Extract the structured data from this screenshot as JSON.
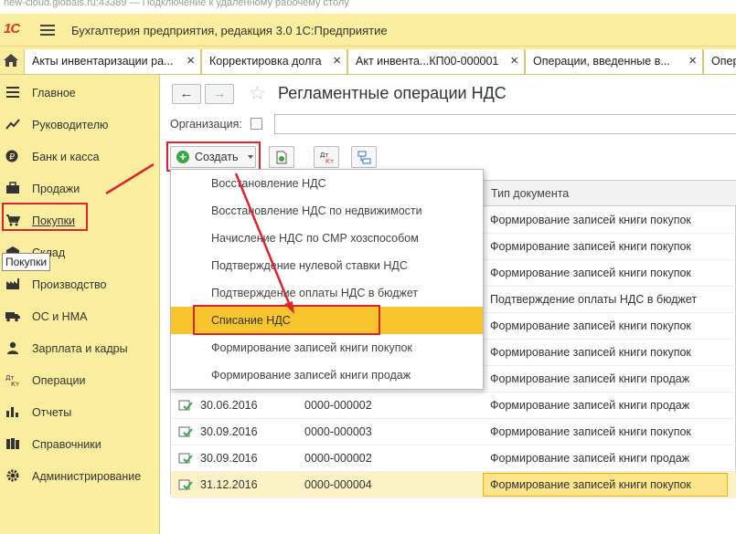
{
  "remote": {
    "title": "new-cloud.globals.ru:43389 — Подключение к удаленному рабочему столу"
  },
  "app": {
    "logo": "1С",
    "title": "Бухгалтерия предприятия, редакция 3.0 1С:Предприятие"
  },
  "tabs": [
    {
      "label": "Акты инвентаризации ра..."
    },
    {
      "label": "Корректировка долга"
    },
    {
      "label": "Акт инвента...КП00-000001"
    },
    {
      "label": "Операции, введенные в..."
    },
    {
      "label": "Опер"
    }
  ],
  "tab_close": "×",
  "sidebar": {
    "items": [
      {
        "label": "Главное",
        "icon": "menu-lines-icon"
      },
      {
        "label": "Руководителю",
        "icon": "chart-line-icon"
      },
      {
        "label": "Банк и касса",
        "icon": "ruble-coin-icon"
      },
      {
        "label": "Продажи",
        "icon": "briefcase-icon"
      },
      {
        "label": "Покупки",
        "icon": "cart-icon"
      },
      {
        "label": "Склад",
        "icon": "warehouse-icon"
      },
      {
        "label": "Производство",
        "icon": "factory-icon"
      },
      {
        "label": "ОС и НМА",
        "icon": "truck-icon"
      },
      {
        "label": "Зарплата и кадры",
        "icon": "person-icon"
      },
      {
        "label": "Операции",
        "icon": "dt-kt-icon"
      },
      {
        "label": "Отчеты",
        "icon": "bar-chart-icon"
      },
      {
        "label": "Справочники",
        "icon": "books-icon"
      },
      {
        "label": "Администрирование",
        "icon": "gear-icon"
      }
    ],
    "tooltip": "Покупки"
  },
  "page": {
    "title": "Регламентные операции НДС",
    "back": "←",
    "forward": "→",
    "star": "☆",
    "org_label": "Организация:",
    "create_label": "Создать"
  },
  "grid": {
    "col_type": "Тип документа",
    "rows_hidden_types": [
      "Формирование записей книги покупок",
      "Формирование записей книги покупок",
      "Формирование записей книги покупок",
      "Подтверждение оплаты НДС в бюджет",
      "Формирование записей книги покупок",
      "Формирование записей книги покупок",
      "Формирование записей книги продаж"
    ],
    "rows": [
      {
        "date": "30.06.2016",
        "number": "0000-000002",
        "type": "Формирование записей книги продаж"
      },
      {
        "date": "30.09.2016",
        "number": "0000-000003",
        "type": "Формирование записей книги покупок"
      },
      {
        "date": "30.09.2016",
        "number": "0000-000002",
        "type": "Формирование записей книги продаж"
      },
      {
        "date": "31.12.2016",
        "number": "0000-000004",
        "type": "Формирование записей книги покупок"
      }
    ]
  },
  "dropdown": {
    "items": [
      "Восстановление НДС",
      "Восстановление НДС по недвижимости",
      "Начисление НДС по СМР хозспособом",
      "Подтверждение нулевой ставки НДС",
      "Подтверждение оплаты НДС в бюджет",
      "Списание НДС",
      "Формирование записей книги покупок",
      "Формирование записей книги продаж"
    ],
    "highlighted_index": 5
  },
  "colors": {
    "panel": "#fbed9e",
    "accent": "#f6c52b",
    "annotation": "#d8262c"
  }
}
